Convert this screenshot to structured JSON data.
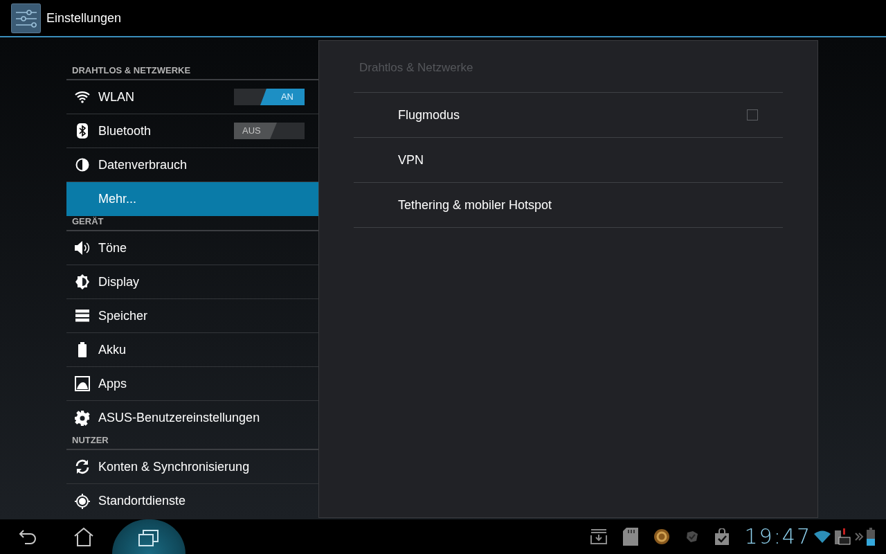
{
  "action_bar": {
    "title": "Einstellungen"
  },
  "sidebar": {
    "sections": [
      {
        "header": "DRAHTLOS & NETZWERKE",
        "items": [
          {
            "label": "WLAN",
            "kind": "toggle",
            "on": true,
            "toggle_label": "AN",
            "selected": false
          },
          {
            "label": "Bluetooth",
            "kind": "toggle",
            "on": false,
            "toggle_label": "AUS",
            "selected": false
          },
          {
            "label": "Datenverbrauch",
            "kind": "plain",
            "selected": false
          },
          {
            "label": "Mehr...",
            "kind": "plain",
            "selected": true
          }
        ]
      },
      {
        "header": "GERÄT",
        "items": [
          {
            "label": "Töne",
            "kind": "plain",
            "selected": false
          },
          {
            "label": "Display",
            "kind": "plain",
            "selected": false
          },
          {
            "label": "Speicher",
            "kind": "plain",
            "selected": false
          },
          {
            "label": "Akku",
            "kind": "plain",
            "selected": false
          },
          {
            "label": "Apps",
            "kind": "plain",
            "selected": false
          },
          {
            "label": "ASUS-Benutzereinstellungen",
            "kind": "plain",
            "selected": false
          }
        ]
      },
      {
        "header": "NUTZER",
        "items": [
          {
            "label": "Konten & Synchronisierung",
            "kind": "plain",
            "selected": false
          },
          {
            "label": "Standortdienste",
            "kind": "plain",
            "selected": false
          }
        ]
      }
    ]
  },
  "detail": {
    "title": "Drahtlos & Netzwerke",
    "items": [
      {
        "label": "Flugmodus",
        "kind": "checkbox",
        "checked": false
      },
      {
        "label": "VPN",
        "kind": "plain"
      },
      {
        "label": "Tethering & mobiler Hotspot",
        "kind": "plain"
      }
    ]
  },
  "system_bar": {
    "time": "19:47"
  }
}
